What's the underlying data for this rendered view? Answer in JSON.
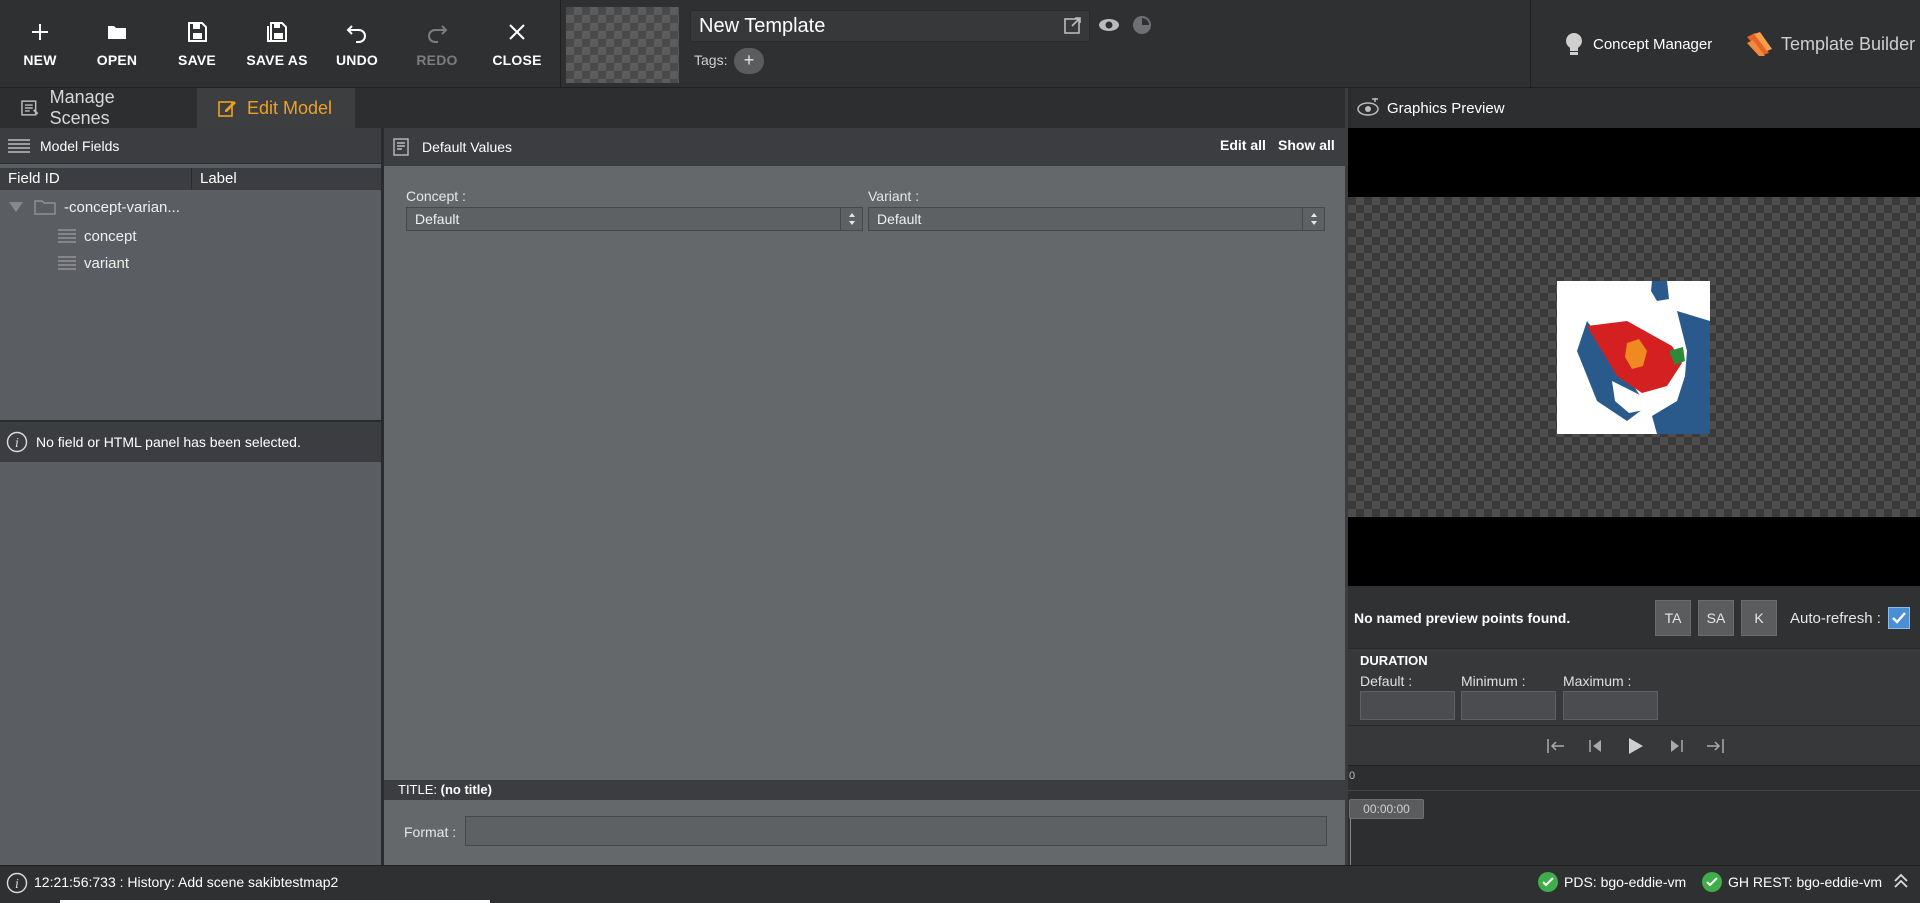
{
  "toolbar": {
    "new": "NEW",
    "open": "OPEN",
    "save": "SAVE",
    "save_as": "SAVE AS",
    "undo": "UNDO",
    "redo": "REDO",
    "close": "CLOSE"
  },
  "template": {
    "name": "New Template",
    "tags_label": "Tags:",
    "tags_add": "+"
  },
  "header_links": {
    "concept_manager": "Concept Manager",
    "template_builder": "Template Builder"
  },
  "tabs": {
    "manage_scenes": "Manage Scenes",
    "edit_model": "Edit Model"
  },
  "model_fields": {
    "title": "Model Fields",
    "col_field_id": "Field ID",
    "col_label": "Label",
    "tree": [
      {
        "label": "-concept-varian..."
      },
      {
        "label": "concept"
      },
      {
        "label": "variant"
      }
    ],
    "message": "No field or HTML panel has been selected."
  },
  "default_values": {
    "title": "Default Values",
    "edit_all": "Edit all",
    "show_all": "Show all",
    "concept_label": "Concept :",
    "concept_value": "Default",
    "variant_label": "Variant :",
    "variant_value": "Default",
    "title_prefix": "TITLE:",
    "title_value": "(no title)",
    "format_label": "Format :"
  },
  "graphics_preview": {
    "title": "Graphics Preview",
    "no_points": "No named preview points found.",
    "btn_ta": "TA",
    "btn_sa": "SA",
    "btn_k": "K",
    "auto_refresh_label": "Auto-refresh :",
    "auto_refresh_checked": true,
    "duration_title": "DURATION",
    "default_label": "Default :",
    "minimum_label": "Minimum :",
    "maximum_label": "Maximum :",
    "timeline_zero": "0",
    "timecode": "00:00:00"
  },
  "status": {
    "message": "12:21:56:733 : History: Add scene sakibtestmap2",
    "pds": "PDS: bgo-eddie-vm",
    "gh_rest": "GH REST: bgo-eddie-vm"
  },
  "colors": {
    "accent": "#f0a020",
    "ok": "#3fae49",
    "checkbox": "#4a8ed6"
  },
  "icons": {
    "new": "plus-icon",
    "open": "folder-icon",
    "save": "floppy-icon",
    "save_as": "floppy-stack-icon",
    "undo": "undo-icon",
    "redo": "redo-icon",
    "close": "close-icon",
    "concept_manager": "lightbulb-icon",
    "template_builder": "brand-logo-icon",
    "graphics_preview": "preview-eye-icon"
  }
}
